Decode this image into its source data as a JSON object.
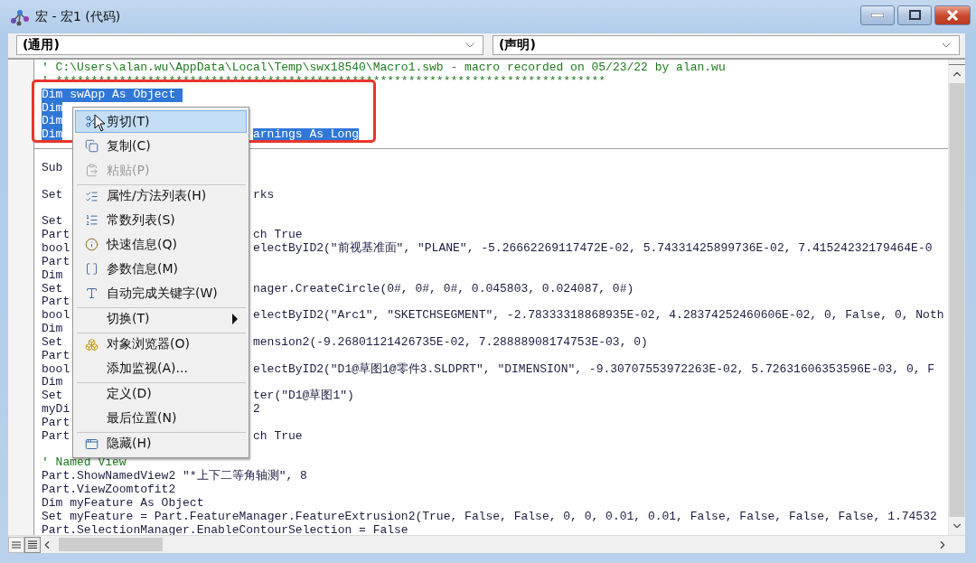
{
  "window": {
    "title": "宏 - 宏1 (代码)"
  },
  "combos": [
    {
      "value": "(通用)"
    },
    {
      "value": "(声明)"
    }
  ],
  "code_lines": [
    {
      "kind": "comment",
      "text": "' C:\\Users\\alan.wu\\AppData\\Local\\Temp\\swx18540\\Macro1.swb - macro recorded on 05/23/22 by alan.wu",
      "selected": false
    },
    {
      "kind": "comment",
      "text": "' ******************************************************************************",
      "selected": false
    },
    {
      "kind": "code",
      "text": "Dim swApp As Object ",
      "selected": true
    },
    {
      "kind": "code",
      "text": "Dim",
      "selected": true
    },
    {
      "kind": "code",
      "text": "Dim",
      "selected": true
    },
    {
      "kind": "code",
      "text": "Dim",
      "continuation": "arnings As Long",
      "selected": true
    },
    {
      "kind": "divider"
    },
    {
      "kind": "blank"
    },
    {
      "kind": "code",
      "text": "Sub",
      "selected": false
    },
    {
      "kind": "blank"
    },
    {
      "kind": "code",
      "text": "Set",
      "continuation": "rks",
      "selected": false
    },
    {
      "kind": "blank"
    },
    {
      "kind": "code",
      "text": "Set",
      "selected": false
    },
    {
      "kind": "code",
      "text": "Part",
      "continuation": "ch True",
      "selected": false
    },
    {
      "kind": "code",
      "text": "bool",
      "continuation": "electByID2(\"前视基准面\", \"PLANE\", -5.26662269117472E-02, 5.74331425899736E-02, 7.41524232179464E-0",
      "selected": false
    },
    {
      "kind": "code",
      "text": "Part",
      "selected": false
    },
    {
      "kind": "code",
      "text": "Dim",
      "selected": false
    },
    {
      "kind": "code",
      "text": "Set",
      "continuation": "nager.CreateCircle(0#, 0#, 0#, 0.045803, 0.024087, 0#)",
      "selected": false
    },
    {
      "kind": "code",
      "text": "Part",
      "selected": false
    },
    {
      "kind": "code",
      "text": "bool",
      "continuation": "electByID2(\"Arc1\", \"SKETCHSEGMENT\", -2.78333318868935E-02, 4.28374252460606E-02, 0, False, 0, Noth",
      "selected": false
    },
    {
      "kind": "code",
      "text": "Dim",
      "selected": false
    },
    {
      "kind": "code",
      "text": "Set",
      "continuation": "mension2(-9.26801121426735E-02, 7.28888908174753E-03, 0)",
      "selected": false
    },
    {
      "kind": "code",
      "text": "Part",
      "selected": false
    },
    {
      "kind": "code",
      "text": "bool",
      "continuation": "electByID2(\"D1@草图1@零件3.SLDPRT\", \"DIMENSION\", -9.30707553972263E-02, 5.72631606353596E-03, 0, F",
      "selected": false
    },
    {
      "kind": "code",
      "text": "Dim",
      "selected": false
    },
    {
      "kind": "code",
      "text": "Set",
      "continuation": "ter(\"D1@草图1\")",
      "selected": false
    },
    {
      "kind": "code",
      "text": "myDi",
      "continuation": "2",
      "selected": false
    },
    {
      "kind": "code",
      "text": "Part",
      "selected": false
    },
    {
      "kind": "code",
      "text": "Part",
      "continuation": "ch True",
      "selected": false
    },
    {
      "kind": "blank"
    },
    {
      "kind": "comment",
      "text": "' Named View",
      "selected": false
    },
    {
      "kind": "code",
      "text": "Part.ShowNamedView2 \"*上下二等角轴测\", 8",
      "selected": false
    },
    {
      "kind": "code",
      "text": "Part.ViewZoomtofit2",
      "selected": false
    },
    {
      "kind": "code",
      "text": "Dim myFeature As Object",
      "selected": false
    },
    {
      "kind": "code",
      "text": "Set myFeature = Part.FeatureManager.FeatureExtrusion2(True, False, False, 0, 0, 0.01, 0.01, False, False, False, False, 1.74532",
      "selected": false
    },
    {
      "kind": "code",
      "text": "Part.SelectionManager.EnableContourSelection = False",
      "selected": false
    }
  ],
  "context_menu": {
    "items": [
      {
        "label": "剪切(T)",
        "selected": true,
        "disabled": false,
        "submenu": false,
        "separator_before": false
      },
      {
        "label": "复制(C)",
        "selected": false,
        "disabled": false,
        "submenu": false,
        "separator_before": false
      },
      {
        "label": "粘贴(P)",
        "selected": false,
        "disabled": true,
        "submenu": false,
        "separator_before": false
      },
      {
        "label": "属性/方法列表(H)",
        "selected": false,
        "disabled": false,
        "submenu": false,
        "separator_before": true
      },
      {
        "label": "常数列表(S)",
        "selected": false,
        "disabled": false,
        "submenu": false,
        "separator_before": false
      },
      {
        "label": "快速信息(Q)",
        "selected": false,
        "disabled": false,
        "submenu": false,
        "separator_before": false
      },
      {
        "label": "参数信息(M)",
        "selected": false,
        "disabled": false,
        "submenu": false,
        "separator_before": false
      },
      {
        "label": "自动完成关键字(W)",
        "selected": false,
        "disabled": false,
        "submenu": false,
        "separator_before": false
      },
      {
        "label": "切换(T)",
        "selected": false,
        "disabled": false,
        "submenu": true,
        "separator_before": true
      },
      {
        "label": "对象浏览器(O)",
        "selected": false,
        "disabled": false,
        "submenu": false,
        "separator_before": true
      },
      {
        "label": "添加监视(A)...",
        "selected": false,
        "disabled": false,
        "submenu": false,
        "separator_before": false
      },
      {
        "label": "定义(D)",
        "selected": false,
        "disabled": false,
        "submenu": false,
        "separator_before": true
      },
      {
        "label": "最后位置(N)",
        "selected": false,
        "disabled": false,
        "submenu": false,
        "separator_before": false
      },
      {
        "label": "隐藏(H)",
        "selected": false,
        "disabled": false,
        "submenu": false,
        "separator_before": true
      }
    ]
  }
}
